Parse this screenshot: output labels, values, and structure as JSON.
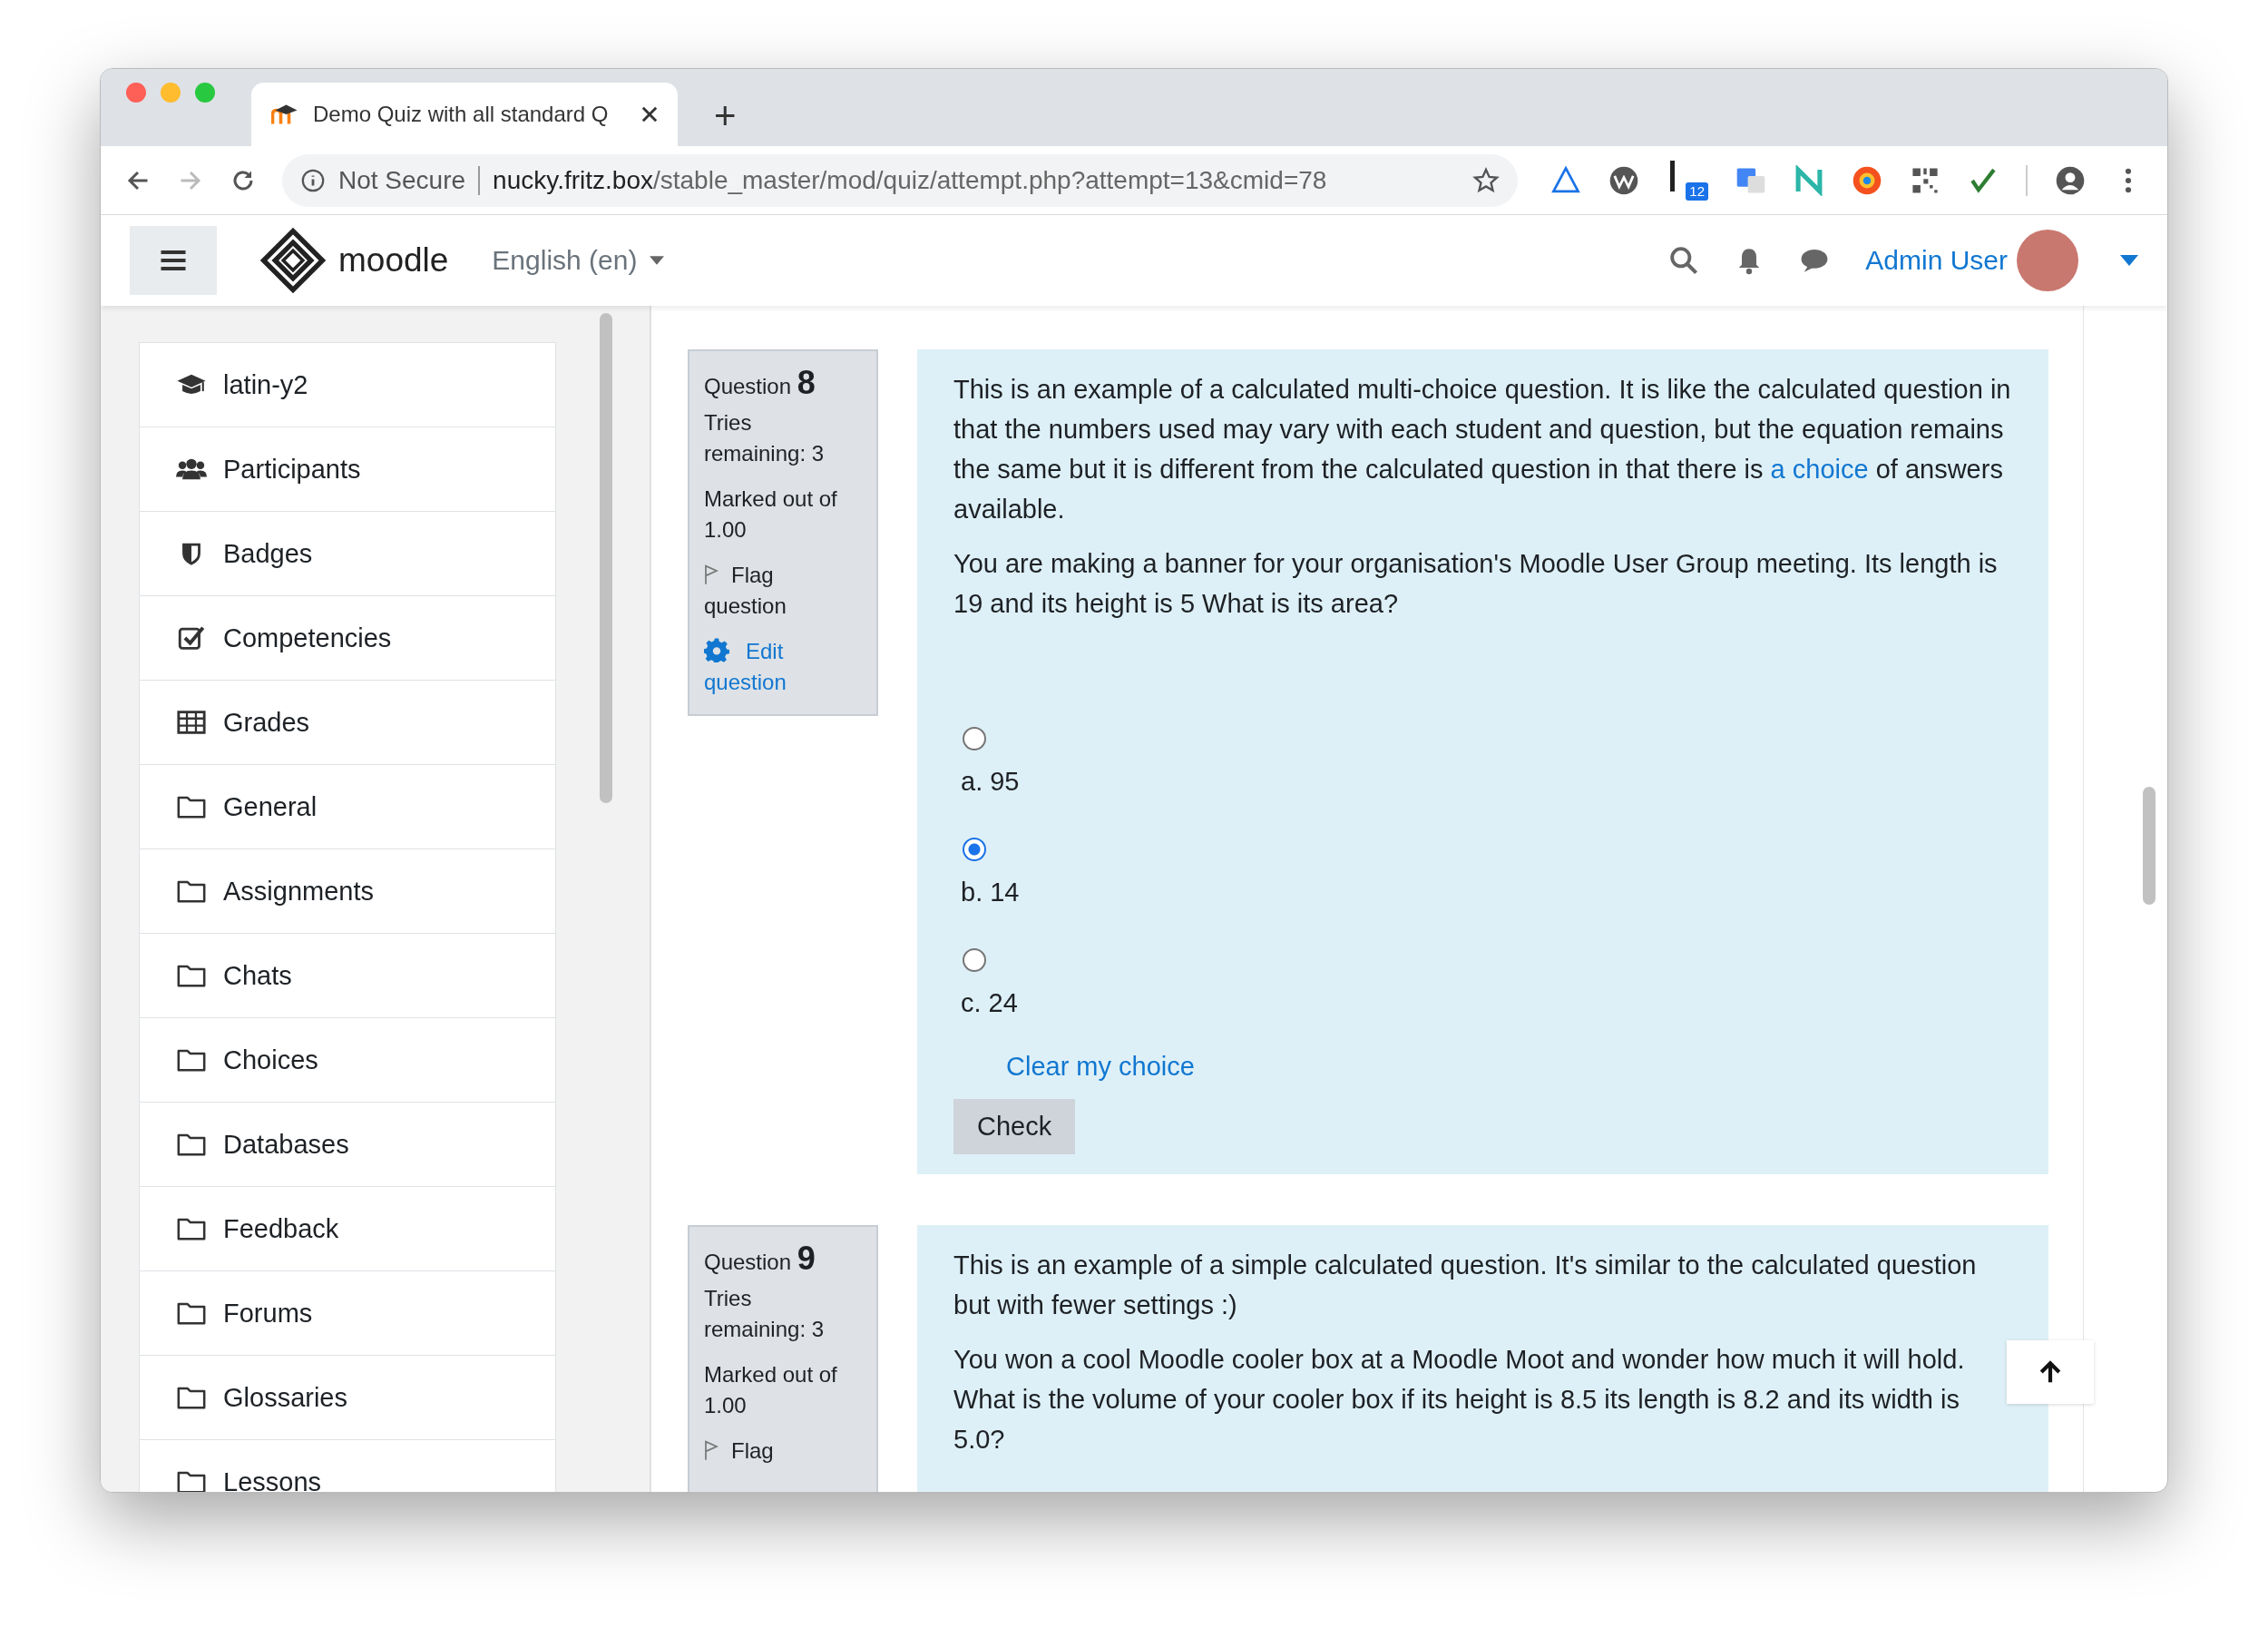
{
  "browser": {
    "tab_title": "Demo Quiz with all standard Q",
    "new_tab": "+",
    "security": "Not Secure",
    "url_host": "nucky.fritz.box",
    "url_path": "/stable_master/mod/quiz/attempt.php?attempt=13&cmid=78",
    "extension_badge": "12"
  },
  "navbar": {
    "brand": "moodle",
    "language": "English (en)",
    "user": "Admin User"
  },
  "sidebar": {
    "items": [
      {
        "label": "latin-y2",
        "kind": "course"
      },
      {
        "label": "Participants",
        "kind": "users"
      },
      {
        "label": "Badges",
        "kind": "shield"
      },
      {
        "label": "Competencies",
        "kind": "check"
      },
      {
        "label": "Grades",
        "kind": "table"
      },
      {
        "label": "General",
        "kind": "folder"
      },
      {
        "label": "Assignments",
        "kind": "folder"
      },
      {
        "label": "Chats",
        "kind": "folder"
      },
      {
        "label": "Choices",
        "kind": "folder"
      },
      {
        "label": "Databases",
        "kind": "folder"
      },
      {
        "label": "Feedback",
        "kind": "folder"
      },
      {
        "label": "Forums",
        "kind": "folder"
      },
      {
        "label": "Glossaries",
        "kind": "folder"
      },
      {
        "label": "Lessons",
        "kind": "folder"
      }
    ]
  },
  "questions": [
    {
      "label": "Question",
      "number": "8",
      "tries": "Tries remaining: 3",
      "marked": "Marked out of 1.00",
      "flag": "Flag question",
      "edit": "Edit question",
      "intro": {
        "before": "This is an example of a calculated multi-choice question. It is like the calculated question in that the numbers used may vary with each student and question, but the equation remains the same but it is different from the calculated question in that there is ",
        "link": "a choice",
        "after": " of answers available."
      },
      "paragraphs": [
        "You are making a banner for your organisation's Moodle User Group meeting. Its length is 19 and its height is 5 What is its area?"
      ],
      "options": [
        {
          "label": "a. 95",
          "selected": false
        },
        {
          "label": "b. 14",
          "selected": true
        },
        {
          "label": "c. 24",
          "selected": false
        }
      ],
      "clear": "Clear my choice",
      "check": "Check"
    },
    {
      "label": "Question",
      "number": "9",
      "tries": "Tries remaining: 3",
      "marked": "Marked out of 1.00",
      "flag": "Flag",
      "paragraphs": [
        "This is an example of a simple calculated question. It's similar to the calculated question but with fewer settings :)",
        "You won a cool Moodle cooler box at a Moodle Moot and wonder how much it will hold. What is the volume of your cooler box if its height is 8.5 its length is 8.2 and its width is 5.0?"
      ]
    }
  ]
}
